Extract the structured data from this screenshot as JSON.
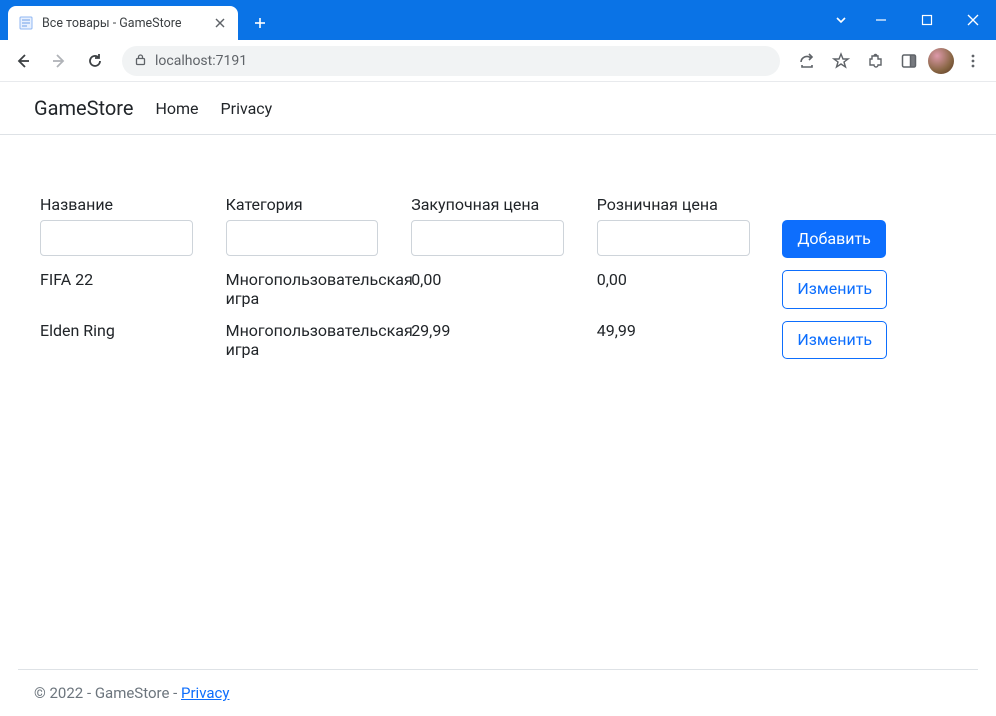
{
  "browser": {
    "tab_title": "Все товары - GameStore",
    "url_host": "localhost:",
    "url_port": "7191"
  },
  "navbar": {
    "brand": "GameStore",
    "links": {
      "home": "Home",
      "privacy": "Privacy"
    }
  },
  "table": {
    "headers": {
      "name": "Название",
      "category": "Категория",
      "purchase_price": "Закупочная цена",
      "retail_price": "Розничная цена"
    },
    "inputs": {
      "name": "",
      "category": "",
      "purchase_price": "",
      "retail_price": ""
    },
    "add_button": "Добавить",
    "edit_button": "Изменить",
    "rows": [
      {
        "name": "FIFA 22",
        "category": "Многопользовательская игра",
        "purchase_price": "0,00",
        "retail_price": "0,00"
      },
      {
        "name": "Elden Ring",
        "category": "Многопользовательская игра",
        "purchase_price": "29,99",
        "retail_price": "49,99"
      }
    ]
  },
  "footer": {
    "text": "© 2022 - GameStore - ",
    "privacy_link": "Privacy"
  }
}
